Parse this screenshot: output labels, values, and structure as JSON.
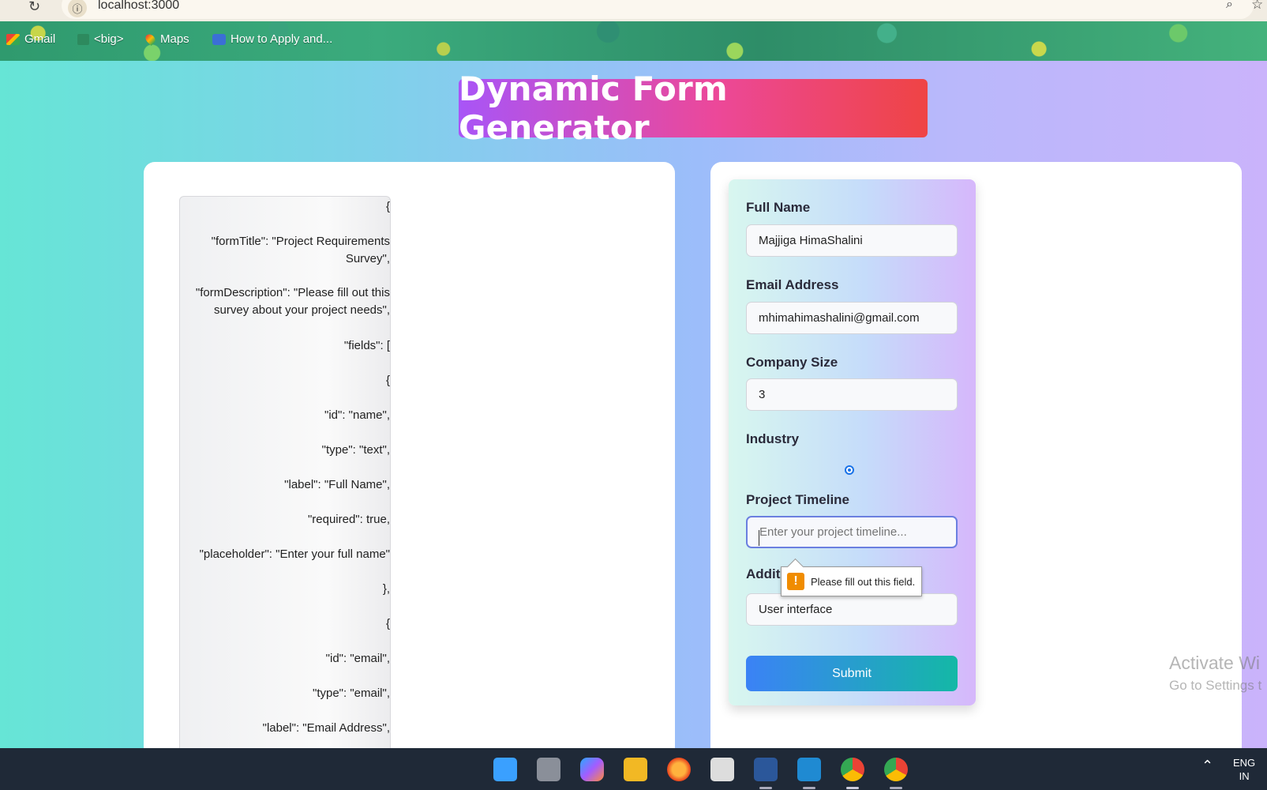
{
  "browser": {
    "url": "localhost:3000",
    "bookmarks": [
      {
        "label": "Gmail",
        "icon": "gmail-icon"
      },
      {
        "label": "<big>",
        "icon": "page-icon"
      },
      {
        "label": "Maps",
        "icon": "maps-icon"
      },
      {
        "label": "How to Apply and...",
        "icon": "bookmark-icon"
      }
    ]
  },
  "page": {
    "title": "Dynamic Form Generator"
  },
  "json_editor": {
    "lines": [
      "{",
      "\"formTitle\": \"Project Requirements",
      "Survey\",",
      "\"formDescription\": \"Please fill out this",
      "survey about your project needs\",",
      "\"fields\": [",
      "{",
      "\"id\": \"name\",",
      "\"type\": \"text\",",
      "\"label\": \"Full Name\",",
      "\"required\": true,",
      "\"placeholder\": \"Enter your full name\"",
      "},",
      "{",
      "\"id\": \"email\",",
      "\"type\": \"email\",",
      "\"label\": \"Email Address\","
    ]
  },
  "form": {
    "full_name": {
      "label": "Full Name",
      "value": "Majjiga HimaShalini"
    },
    "email": {
      "label": "Email Address",
      "value": "mhimahimashalini@gmail.com"
    },
    "company_size": {
      "label": "Company Size",
      "value": "3"
    },
    "industry": {
      "label": "Industry"
    },
    "project_timeline": {
      "label": "Project Timeline",
      "placeholder": "Enter your project timeline..."
    },
    "additional": {
      "label": "Additi",
      "value": "User interface"
    },
    "validation_message": "Please fill out this field.",
    "submit_label": "Submit"
  },
  "watermark": {
    "line1": "Activate Wi",
    "line2": "Go to Settings t"
  },
  "taskbar": {
    "lang_line1": "ENG",
    "lang_line2": "IN",
    "apps": [
      "start-icon",
      "task-view-icon",
      "copilot-icon",
      "file-explorer-icon",
      "firefox-icon",
      "clapperboard-icon",
      "word-icon",
      "vscode-icon",
      "chrome-icon",
      "chrome-profile-icon"
    ]
  },
  "colors": {
    "title_gradient": [
      "#a855f7",
      "#ec4899",
      "#ef4444"
    ],
    "submit_gradient": [
      "#3b82f6",
      "#14b8a6"
    ],
    "focus_border": "#6b7fe0",
    "warning": "#f08c00"
  }
}
